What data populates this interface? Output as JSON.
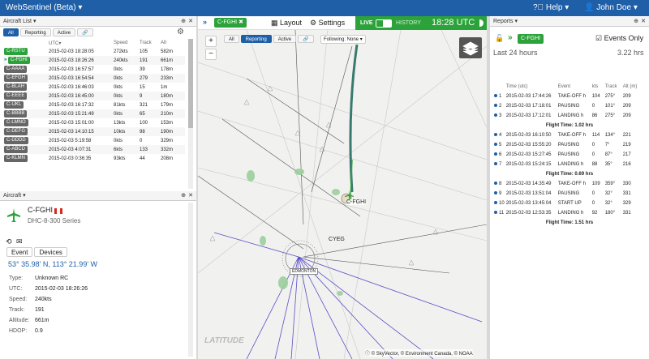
{
  "app": {
    "title": "WebSentinel (Beta)",
    "help": "Help",
    "user": "John Doe",
    "accent": "#1f5fa8",
    "green": "#2ca33a"
  },
  "aircraft_list": {
    "title": "Aircraft List",
    "tabs": [
      "All",
      "Reporting",
      "Active"
    ],
    "headers": [
      "UTC",
      "Speed",
      "Track",
      "Alt"
    ],
    "rows": [
      {
        "callsign": "C-RSTU",
        "utc": "2015-02-03 18:28:05",
        "speed": "272kts",
        "track": "105",
        "alt": "582m",
        "status": "green"
      },
      {
        "callsign": "C-FGHI",
        "utc": "2015-02-03 18:26:26",
        "speed": "240kts",
        "track": "191",
        "alt": "661m",
        "status": "green-selected"
      },
      {
        "callsign": "C-AAAA",
        "utc": "2015-02-03 16:57:57",
        "speed": "0kts",
        "track": "39",
        "alt": "178m",
        "status": "gray"
      },
      {
        "callsign": "C-EFGH",
        "utc": "2015-02-03 16:54:54",
        "speed": "0kts",
        "track": "279",
        "alt": "233m",
        "status": "gray"
      },
      {
        "callsign": "C-BLAH",
        "utc": "2015-02-03 16:46:03",
        "speed": "0kts",
        "track": "15",
        "alt": "1m",
        "status": "gray"
      },
      {
        "callsign": "C-EEEE",
        "utc": "2015-02-03 16:45:00",
        "speed": "0kts",
        "track": "9",
        "alt": "180m",
        "status": "gray"
      },
      {
        "callsign": "C-IJKL",
        "utc": "2015-02-03 16:17:32",
        "speed": "81kts",
        "track": "321",
        "alt": "179m",
        "status": "gray"
      },
      {
        "callsign": "C-BBBB",
        "utc": "2015-02-03 15:21:49",
        "speed": "0kts",
        "track": "65",
        "alt": "210m",
        "status": "gray"
      },
      {
        "callsign": "C-LMNO",
        "utc": "2015-02-03 15:01:00",
        "speed": "13kts",
        "track": "100",
        "alt": "153m",
        "status": "gray"
      },
      {
        "callsign": "C-DEFG",
        "utc": "2015-02-03 14:10:15",
        "speed": "10kts",
        "track": "98",
        "alt": "190m",
        "status": "gray"
      },
      {
        "callsign": "C-DDDD",
        "utc": "2015-02-03 5:19:58",
        "speed": "0kts",
        "track": "0",
        "alt": "329m",
        "status": "gray"
      },
      {
        "callsign": "C-ABCD",
        "utc": "2015-02-03 4:07:31",
        "speed": "6kts",
        "track": "133",
        "alt": "332m",
        "status": "gray"
      },
      {
        "callsign": "C-KLMN",
        "utc": "2015-02-03 0:36:35",
        "speed": "93kts",
        "track": "44",
        "alt": "208m",
        "status": "gray"
      }
    ]
  },
  "aircraft": {
    "title": "Aircraft",
    "callsign": "C-FGHI",
    "type_name": "DHC-8-300 Series",
    "tabs": [
      "Event",
      "Devices"
    ],
    "position": "53° 35.98' N, 113° 21.99' W",
    "details": [
      {
        "label": "Type:",
        "value": "Unknown RC"
      },
      {
        "label": "UTC:",
        "value": "2015-02-03 18:26:26"
      },
      {
        "label": "Speed:",
        "value": "240kts"
      },
      {
        "label": "Track:",
        "value": "191"
      },
      {
        "label": "Altitude:",
        "value": "661m"
      },
      {
        "label": "HDOP:",
        "value": "0.9"
      }
    ]
  },
  "map": {
    "callsign": "C-FGHI",
    "layout": "Layout",
    "settings": "Settings",
    "tabs": [
      "All",
      "Reporting",
      "Active"
    ],
    "following": "Following: None",
    "live": "LIVE",
    "history": "HISTORY",
    "time": "18:28 UTC",
    "zoom_in": "+",
    "zoom_out": "−",
    "aircraft_label": "C-FGHI",
    "airport": "CYEG",
    "vor": "EDMONTON",
    "attribution": "© SkyVector, © Environment Canada, © NOAA",
    "logo": "LATITUDE"
  },
  "reports": {
    "title": "Reports",
    "callsign": "C-FGHI",
    "events_only": "Events Only",
    "period": "Last 24 hours",
    "distance": "3.22 hrs",
    "headers": [
      "Time (utc)",
      "Event",
      "kts",
      "Track",
      "Alt (m)"
    ],
    "rows": [
      {
        "n": "1",
        "time": "2015-02-03 17:44:26",
        "event": "TAKE-OFF h",
        "kts": "104",
        "track": "275°",
        "alt": "209"
      },
      {
        "n": "2",
        "time": "2015-02-03 17:18:01",
        "event": "PAUSING",
        "kts": "0",
        "track": "101°",
        "alt": "209"
      },
      {
        "n": "3",
        "time": "2015-02-03 17:12:01",
        "event": "LANDING h",
        "kts": "86",
        "track": "275°",
        "alt": "209"
      },
      {
        "ft": "Flight Time: 1.02 hrs"
      },
      {
        "n": "4",
        "time": "2015-02-03 16:10:50",
        "event": "TAKE-OFF h",
        "kts": "114",
        "track": "134°",
        "alt": "221"
      },
      {
        "n": "5",
        "time": "2015-02-03 15:55:20",
        "event": "PAUSING",
        "kts": "0",
        "track": "7°",
        "alt": "219"
      },
      {
        "n": "6",
        "time": "2015-02-03 15:27:45",
        "event": "PAUSING",
        "kts": "0",
        "track": "87°",
        "alt": "217"
      },
      {
        "n": "7",
        "time": "2015-02-03 15:24:15",
        "event": "LANDING h",
        "kts": "88",
        "track": "35°",
        "alt": "216"
      },
      {
        "ft": "Flight Time: 0.69 hrs"
      },
      {
        "n": "8",
        "time": "2015-02-03 14:35:49",
        "event": "TAKE-OFF h",
        "kts": "109",
        "track": "359°",
        "alt": "330"
      },
      {
        "n": "9",
        "time": "2015-02-03 13:51:04",
        "event": "PAUSING",
        "kts": "0",
        "track": "32°",
        "alt": "331"
      },
      {
        "n": "10",
        "time": "2015-02-03 13:45:04",
        "event": "START UP",
        "kts": "0",
        "track": "32°",
        "alt": "329"
      },
      {
        "n": "11",
        "time": "2015-02-03 12:53:35",
        "event": "LANDING h",
        "kts": "92",
        "track": "180°",
        "alt": "331"
      },
      {
        "ft": "Flight Time: 1.51 hrs"
      }
    ]
  }
}
